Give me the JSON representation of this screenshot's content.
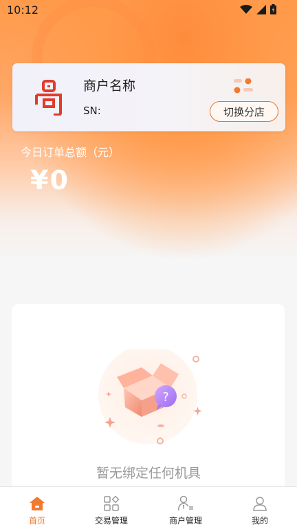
{
  "status_bar": {
    "time": "10:12",
    "icons": [
      "wifi-icon",
      "signal-icon",
      "battery-icon"
    ]
  },
  "merchant": {
    "name": "商户名称",
    "sn_label": "SN:",
    "switch_store_label": "切换分店"
  },
  "summary": {
    "label": "今日订单总额（元）",
    "value": "¥0"
  },
  "empty_state": {
    "message": "暂无绑定任何机具",
    "icon": "empty-box-question-icon"
  },
  "tabbar": {
    "tabs": [
      {
        "label": "首页",
        "icon": "home-icon",
        "active": true
      },
      {
        "label": "交易管理",
        "icon": "grid-icon",
        "active": false
      },
      {
        "label": "商户管理",
        "icon": "merchant-user-icon",
        "active": false
      },
      {
        "label": "我的",
        "icon": "person-icon",
        "active": false
      }
    ]
  },
  "colors": {
    "accent": "#f07a30",
    "hero_orange": "#ff9a4a",
    "logo_red": "#e23b2c"
  }
}
